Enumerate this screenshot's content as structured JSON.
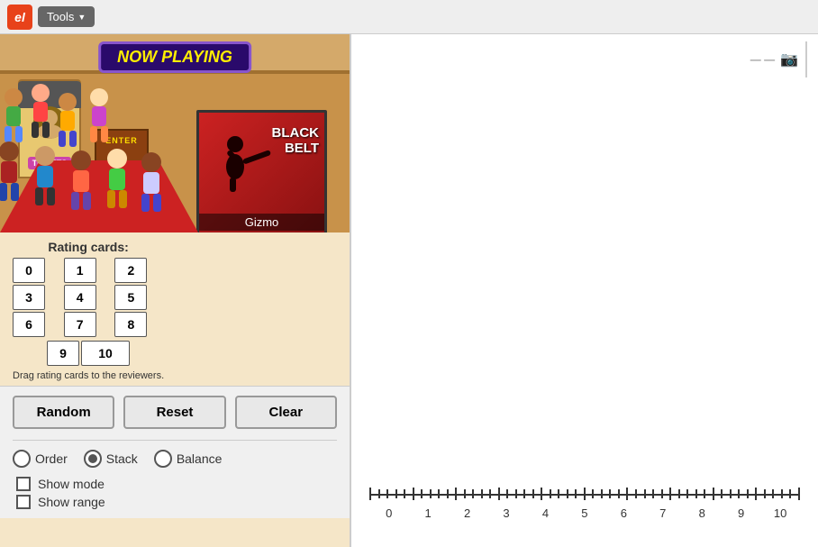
{
  "toolbar": {
    "logo_text": "el",
    "tools_label": "Tools"
  },
  "theater": {
    "now_playing": "NOW PLAYING",
    "movie_title": "BLACK BELT",
    "movie_subtitle": "Gizmo",
    "tickets_label": "TICKETS",
    "enter_label": "ENTER"
  },
  "rating_cards": {
    "label": "Rating cards:",
    "cards": [
      "0",
      "1",
      "2",
      "3",
      "4",
      "5",
      "6",
      "7",
      "8",
      "9",
      "10"
    ],
    "drag_hint": "Drag rating cards to the reviewers."
  },
  "buttons": {
    "random": "Random",
    "reset": "Reset",
    "clear": "Clear"
  },
  "radio_options": [
    {
      "id": "order",
      "label": "Order",
      "selected": false
    },
    {
      "id": "stack",
      "label": "Stack",
      "selected": true
    },
    {
      "id": "balance",
      "label": "Balance",
      "selected": false
    }
  ],
  "checkboxes": [
    {
      "id": "show-mode",
      "label": "Show mode",
      "checked": false
    },
    {
      "id": "show-range",
      "label": "Show range",
      "checked": false
    }
  ],
  "number_line": {
    "labels": [
      "0",
      "1",
      "2",
      "3",
      "4",
      "5",
      "6",
      "7",
      "8",
      "9",
      "10"
    ]
  }
}
